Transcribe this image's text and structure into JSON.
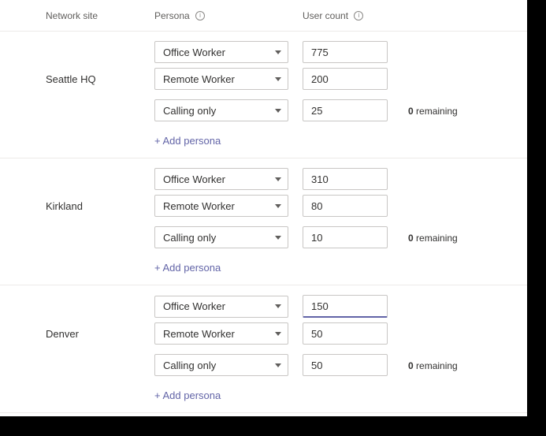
{
  "headers": {
    "site": "Network site",
    "persona": "Persona",
    "count": "User count"
  },
  "add_label": "+ Add persona",
  "remaining_word": "remaining",
  "sites": [
    {
      "name": "Seattle HQ",
      "rows": [
        {
          "persona": "Office Worker",
          "count": "775",
          "focused": false
        },
        {
          "persona": "Remote Worker",
          "count": "200",
          "focused": false
        },
        {
          "persona": "Calling only",
          "count": "25",
          "focused": false
        }
      ],
      "remaining": "0"
    },
    {
      "name": "Kirkland",
      "rows": [
        {
          "persona": "Office Worker",
          "count": "310",
          "focused": false
        },
        {
          "persona": "Remote Worker",
          "count": "80",
          "focused": false
        },
        {
          "persona": "Calling only",
          "count": "10",
          "focused": false
        }
      ],
      "remaining": "0"
    },
    {
      "name": "Denver",
      "rows": [
        {
          "persona": "Office Worker",
          "count": "150",
          "focused": true
        },
        {
          "persona": "Remote Worker",
          "count": "50",
          "focused": false
        },
        {
          "persona": "Calling only",
          "count": "50",
          "focused": false
        }
      ],
      "remaining": "0"
    }
  ]
}
